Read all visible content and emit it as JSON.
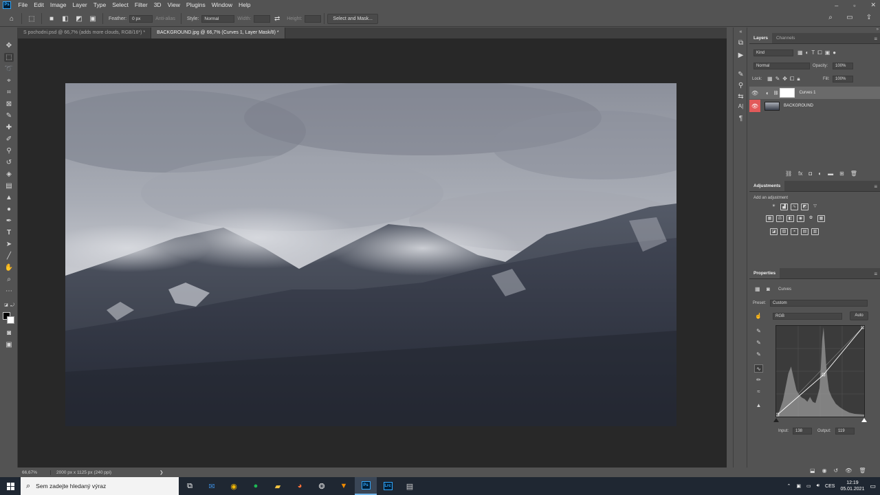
{
  "app": {
    "logo": "Ps"
  },
  "menu": [
    "File",
    "Edit",
    "Image",
    "Layer",
    "Type",
    "Select",
    "Filter",
    "3D",
    "View",
    "Plugins",
    "Window",
    "Help"
  ],
  "window_controls": [
    "–",
    "▫",
    "✕"
  ],
  "options": {
    "feather_label": "Feather:",
    "feather_value": "0 px",
    "antialias_label": "Anti-alias",
    "style_label": "Style:",
    "style_value": "Normal",
    "width_label": "Width:",
    "height_label": "Height:",
    "select_mask_button": "Select and Mask..."
  },
  "tabs": [
    {
      "label": "S pochodni.psd @ 66,7% (adds more clouds, RGB/16*) *",
      "active": false
    },
    {
      "label": "BACKGROUND.jpg @ 66,7% (Curves 1, Layer Mask/8) *",
      "active": true
    }
  ],
  "status": {
    "zoom": "66,67%",
    "doc_size": "2000 px x 1125 px (240 ppi)",
    "chevron": "❯"
  },
  "layers_panel": {
    "tabs": [
      "Layers",
      "Channels"
    ],
    "kind": "Kind",
    "blend_mode": "Normal",
    "opacity_label": "Opacity:",
    "opacity_value": "100%",
    "lock_label": "Lock:",
    "fill_label": "Fill:",
    "fill_value": "100%",
    "layers": [
      {
        "name": "Curves 1",
        "selected": true
      },
      {
        "name": "BACKGROUND",
        "selected": false
      }
    ]
  },
  "adjustments_panel": {
    "title": "Adjustments",
    "subtitle": "Add an adjustment"
  },
  "properties_panel": {
    "title": "Properties",
    "kind": "Curves",
    "preset_label": "Preset:",
    "preset_value": "Custom",
    "channel": "RGB",
    "auto_button": "Auto",
    "input_label": "Input:",
    "input_value": "138",
    "output_label": "Output:",
    "output_value": "119"
  },
  "taskbar": {
    "search_placeholder": "Sem zadejte hledaný výraz",
    "language": "CES",
    "time": "12:19",
    "date": "05.01.2021"
  },
  "colors": {
    "accent_red": "#e25a5a",
    "panel_bg": "#535353",
    "canvas_bg": "#282828"
  }
}
